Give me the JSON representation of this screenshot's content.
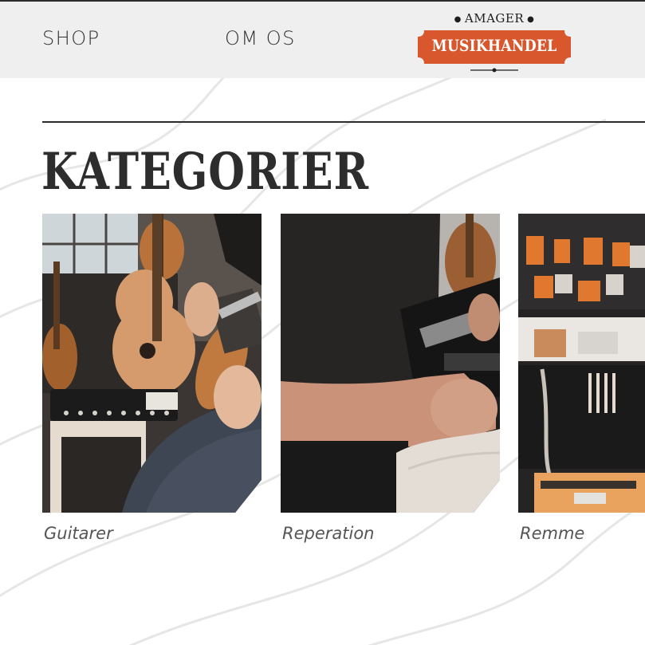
{
  "nav": {
    "shop": "SHOP",
    "om_os": "OM OS"
  },
  "logo": {
    "top": "AMAGER",
    "main": "MUSIKHANDEL"
  },
  "heading": "KATEGORIER",
  "categories": [
    {
      "label": "Guitarer"
    },
    {
      "label": "Reperation"
    },
    {
      "label": "Remme"
    }
  ],
  "colors": {
    "brand_orange": "#d9572d",
    "nav_background": "#efefef",
    "text_dark": "#2d2d2d"
  }
}
